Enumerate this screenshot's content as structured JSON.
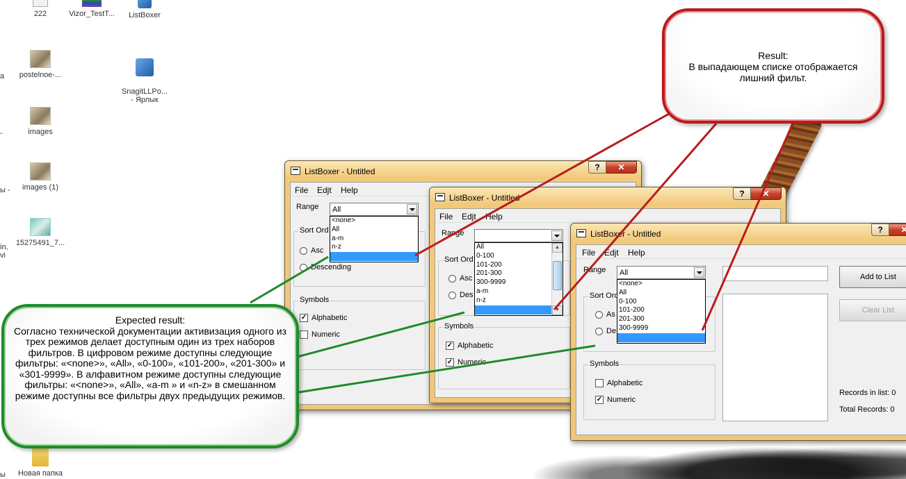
{
  "desktop": {
    "icons": [
      {
        "label": "222"
      },
      {
        "label": "Vizor_TestT..."
      },
      {
        "label": "ListBoxer"
      },
      {
        "label": "postelnoe-..."
      },
      {
        "label": "SnagitLLPo...\n- Ярлык"
      },
      {
        "label": "images"
      },
      {
        "label": "images (1)"
      },
      {
        "label": "15275491_7..."
      },
      {
        "label": "Новая папка"
      }
    ],
    "edge_fragments": [
      "а",
      "-",
      "ы -",
      "in,\nvi",
      "ы"
    ]
  },
  "windows": [
    {
      "title": "ListBoxer - Untitled",
      "menu": [
        "File",
        "Edjt",
        "Help"
      ],
      "range_label": "Range",
      "range_value": "All",
      "dropdown_options": [
        "<none>",
        "All",
        "a-m",
        "n-z",
        ""
      ],
      "sort_order_label": "Sort Ord",
      "radio_asc": "Asc",
      "radio_desc": "Descending",
      "symbols_label": "Symbols",
      "chk_alphabetic": "Alphabetic",
      "chk_numeric": "Numeric",
      "alphabetic_checked": true,
      "numeric_checked": false
    },
    {
      "title": "ListBoxer - Untitled",
      "menu": [
        "File",
        "Edjt",
        "Help"
      ],
      "range_label": "Range",
      "range_value": "",
      "dropdown_options": [
        "All",
        "0-100",
        "101-200",
        "201-300",
        "300-9999",
        "a-m",
        "n-z",
        ""
      ],
      "sort_order_label": "Sort Ord",
      "radio_asc": "Asc",
      "radio_desc": "Des",
      "symbols_label": "Symbols",
      "chk_alphabetic": "Alphabetic",
      "chk_numeric": "Numeric",
      "alphabetic_checked": true,
      "numeric_checked": true
    },
    {
      "title": "ListBoxer - Untitled",
      "menu": [
        "File",
        "Edjt",
        "Help"
      ],
      "range_label": "Range",
      "range_value": "All",
      "dropdown_options": [
        "<none>",
        "All",
        "0-100",
        "101-200",
        "201-300",
        "300-9999",
        ""
      ],
      "sort_order_label": "Sort Ord",
      "radio_asc": "As",
      "radio_desc": "De",
      "symbols_label": "Symbols",
      "chk_alphabetic": "Alphabetic",
      "chk_numeric": "Numeric",
      "alphabetic_checked": false,
      "numeric_checked": true,
      "add_button": "Add to List",
      "clear_button": "Clear List",
      "records_in_list": "Records in list: 0",
      "total_records": "Total Records: 0"
    }
  ],
  "callouts": {
    "result_title": "Result:",
    "result_body": "В выпадающем списке отображается лишний фильт.",
    "expected_title": "Expected result:",
    "expected_body": "Согласно технической документации активизация одного из трех режимов делает доступным один из трех наборов фильтров. В цифровом режиме доступны следующие фильтры: «<none>», «All», «0-100», «101-200», «201-300» и «301-9999». В алфавитном режиме доступны следующие фильтры: «<none>», «All», «a-m » и «n-z»  в смешанном режиме доступны все фильтры двух предыдущих режимов."
  },
  "colors": {
    "result_border": "#b81c1c",
    "expected_border": "#1f8a2a",
    "selection": "#3399ff",
    "window_frame": "#f2c97a"
  }
}
